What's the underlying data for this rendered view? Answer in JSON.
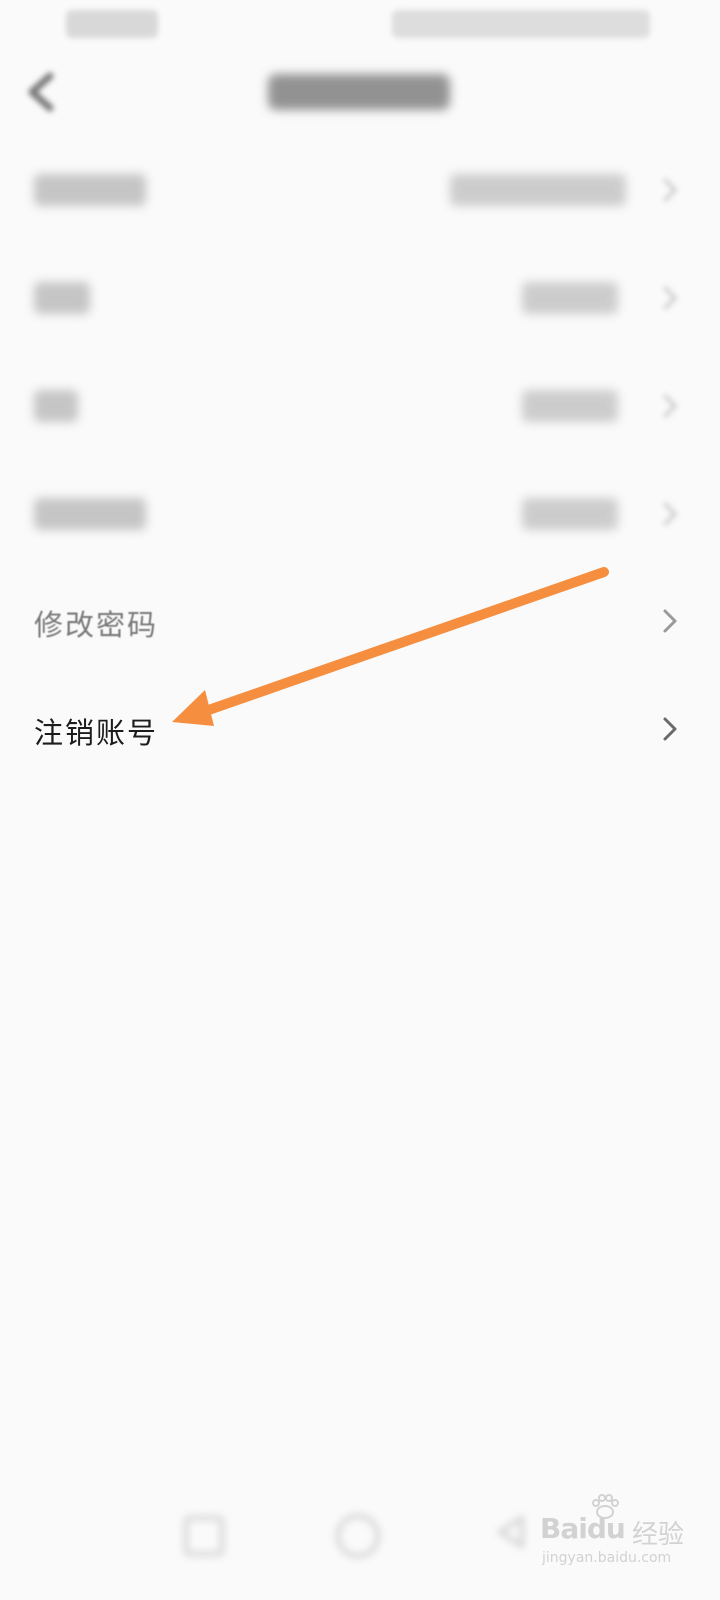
{
  "screen": {
    "background": "#fafafa"
  },
  "list": {
    "change_password_label": "修改密码",
    "deactivate_account_label": "注销账号"
  },
  "annotation": {
    "arrow_color": "#f68e3f"
  },
  "watermark": {
    "logo_text": "Baidu",
    "logo_sub": "经验",
    "url": "jingyan.baidu.com"
  }
}
